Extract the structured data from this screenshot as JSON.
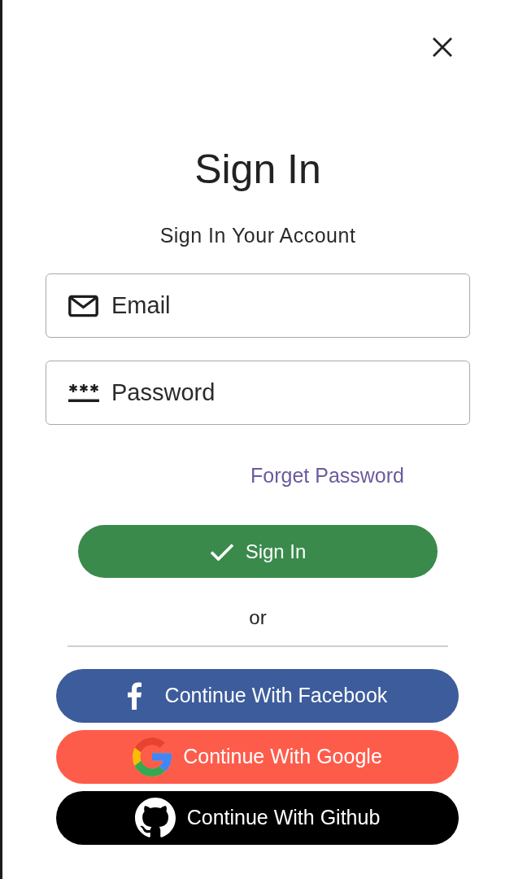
{
  "title": "Sign In",
  "subtitle": "Sign In Your Account",
  "fields": [
    {
      "kind": "email",
      "placeholder": "Email"
    },
    {
      "kind": "password",
      "placeholder": "Password"
    }
  ],
  "forgot_link": "Forget Password",
  "sign_in_button": {
    "label": "Sign In"
  },
  "separator": "or",
  "social_buttons": [
    {
      "kind": "facebook",
      "label": "Continue With Facebook",
      "color": "#3d5c9c"
    },
    {
      "kind": "google",
      "label": "Continue With Google",
      "color": "#fe5c4b"
    },
    {
      "kind": "github",
      "label": "Continue With Github",
      "color": "#000000"
    }
  ]
}
